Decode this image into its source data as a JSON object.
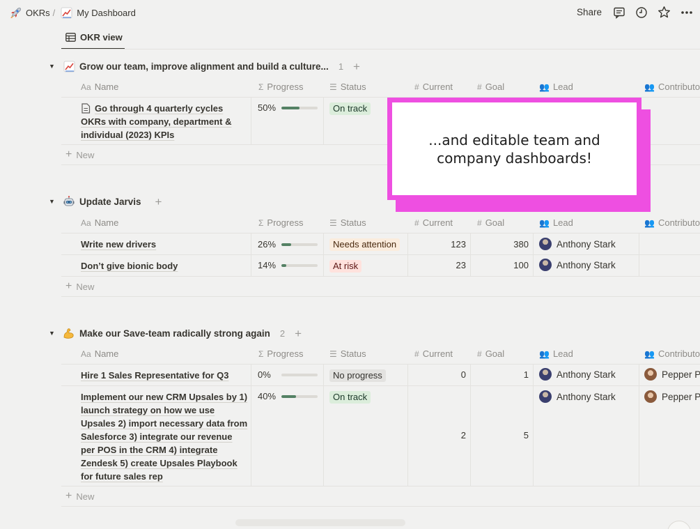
{
  "breadcrumb": {
    "root_label": "OKRs",
    "separator": "/",
    "page_label": "My Dashboard"
  },
  "topbar": {
    "share_label": "Share"
  },
  "view_tab": {
    "label": "OKR view"
  },
  "columns": {
    "name": "Name",
    "name_icon": "Aa",
    "progress": "Progress",
    "progress_icon": "Σ",
    "status": "Status",
    "current": "Current",
    "current_icon": "#",
    "goal": "Goal",
    "goal_icon": "#",
    "lead": "Lead",
    "contributor": "Contributo"
  },
  "new_label": "New",
  "groups": [
    {
      "title": "Grow our team, improve alignment and build a culture...",
      "count": "1",
      "rows": [
        {
          "name": "Go through 4 quarterly cycles OKRs with company, department & individual (2023) KPIs",
          "progress_label": "50%",
          "progress": 0.5,
          "status": "On track",
          "current": "",
          "goal": "",
          "lead": "",
          "contributor": ""
        }
      ]
    },
    {
      "title": "Update Jarvis",
      "rows": [
        {
          "name": "Write new drivers",
          "progress_label": "26%",
          "progress": 0.26,
          "status": "Needs attention",
          "current": "123",
          "goal": "380",
          "lead": "Anthony Stark",
          "contributor": ""
        },
        {
          "name": "Don’t give bionic body",
          "progress_label": "14%",
          "progress": 0.14,
          "status": "At risk",
          "current": "23",
          "goal": "100",
          "lead": "Anthony Stark",
          "contributor": ""
        }
      ]
    },
    {
      "title": "Make our Save-team radically strong again",
      "count": "2",
      "rows": [
        {
          "name": "Hire 1 Sales Representative for Q3",
          "progress_label": "0%",
          "progress": 0,
          "status": "No progress",
          "current": "0",
          "goal": "1",
          "lead": "Anthony Stark",
          "contributor": "Pepper P"
        },
        {
          "name": "Implement our new CRM Upsales by 1) launch strategy on how we use Upsales 2) import necessary data from Salesforce 3) integrate our revenue per POS in the CRM 4) integrate Zendesk 5) create Upsales Playbook for future sales rep",
          "progress_label": "40%",
          "progress": 0.4,
          "status": "On track",
          "current": "2",
          "goal": "5",
          "lead": "Anthony Stark",
          "contributor": "Pepper P"
        }
      ]
    }
  ],
  "callout": {
    "text": "...and editable team and company dashboards!"
  },
  "colors": {
    "accent_magenta": "#ee4fe1",
    "on_track_bg": "#dbeddb",
    "on_track_fg": "#1c3829",
    "needs_attention_bg": "#fbecdd",
    "needs_attention_fg": "#49290e",
    "at_risk_bg": "#ffe2dd",
    "at_risk_fg": "#5d1715",
    "no_progress_bg": "#e3e2e0",
    "no_progress_fg": "#32302c",
    "progress_fill": "#548164"
  },
  "icons": {
    "root": "rocket-icon",
    "page": "chart-increasing-icon",
    "comments": "comment-icon",
    "updates": "clock-icon",
    "favorite": "star-icon",
    "more": "more-icon",
    "tab": "table-icon",
    "group1": "chart-increasing-icon",
    "group2": "robot-icon",
    "group3": "flexed-biceps-icon"
  }
}
